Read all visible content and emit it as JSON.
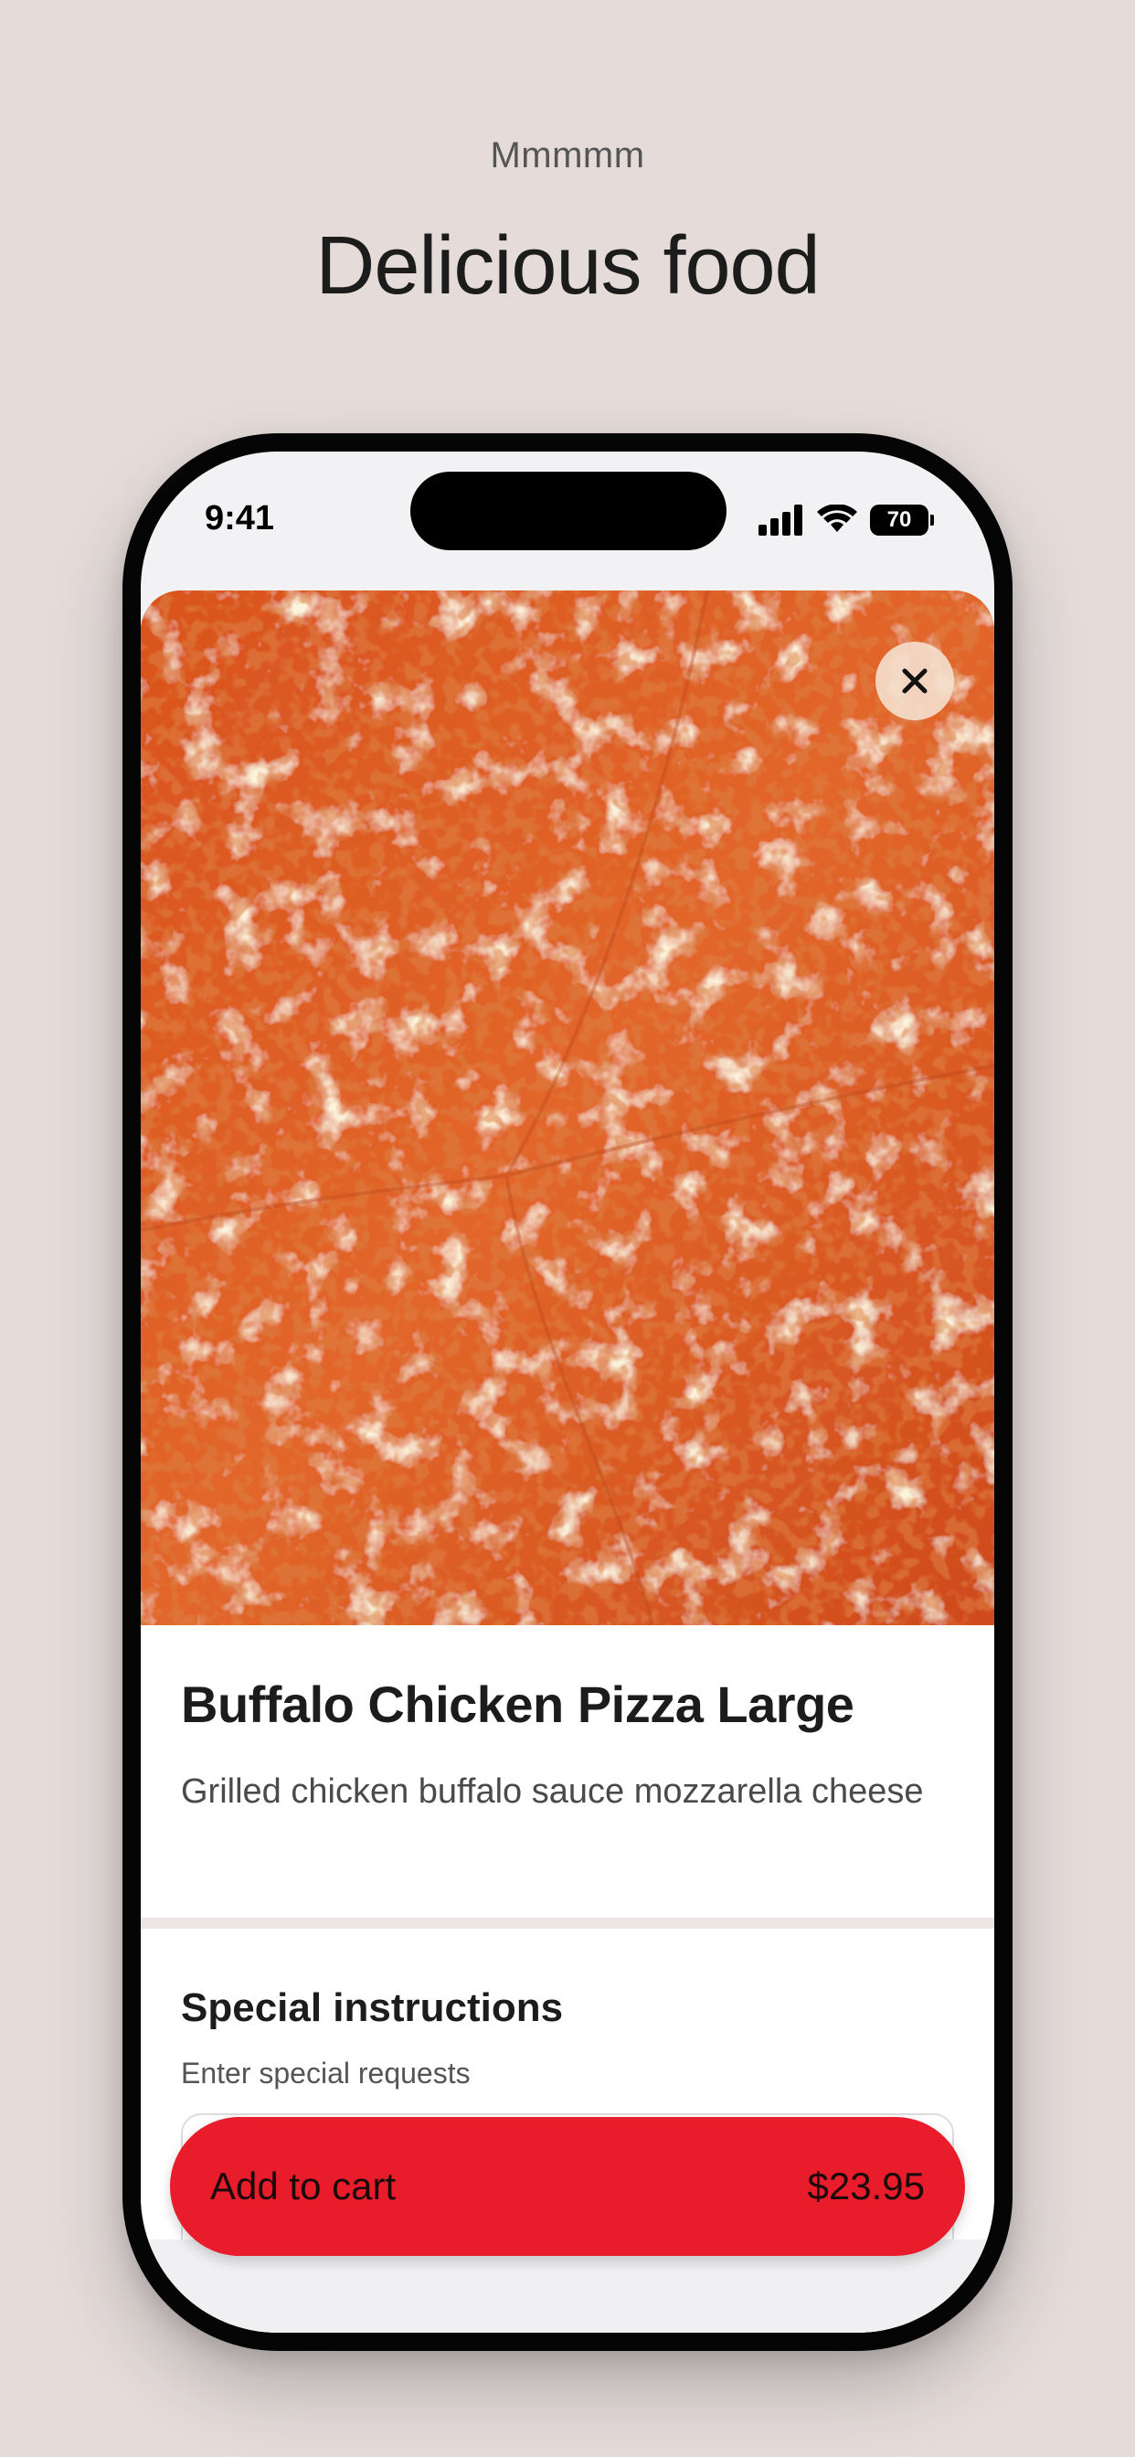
{
  "header": {
    "eyebrow": "Mmmmm",
    "title": "Delicious food"
  },
  "status_bar": {
    "time": "9:41",
    "battery": "70",
    "icons": [
      "cellular-signal-icon",
      "wifi-icon",
      "battery-icon"
    ]
  },
  "product": {
    "image_alt": "cheese pizza photo",
    "close_icon": "close-icon",
    "title": "Buffalo Chicken Pizza Large",
    "description": "Grilled chicken buffalo sauce mozzarella cheese"
  },
  "special_instructions": {
    "title": "Special instructions",
    "hint": "Enter special requests",
    "value": ""
  },
  "cart_button": {
    "label": "Add to cart",
    "price": "$23.95"
  },
  "colors": {
    "background": "#e5dcda",
    "accent": "#e81c2a"
  }
}
